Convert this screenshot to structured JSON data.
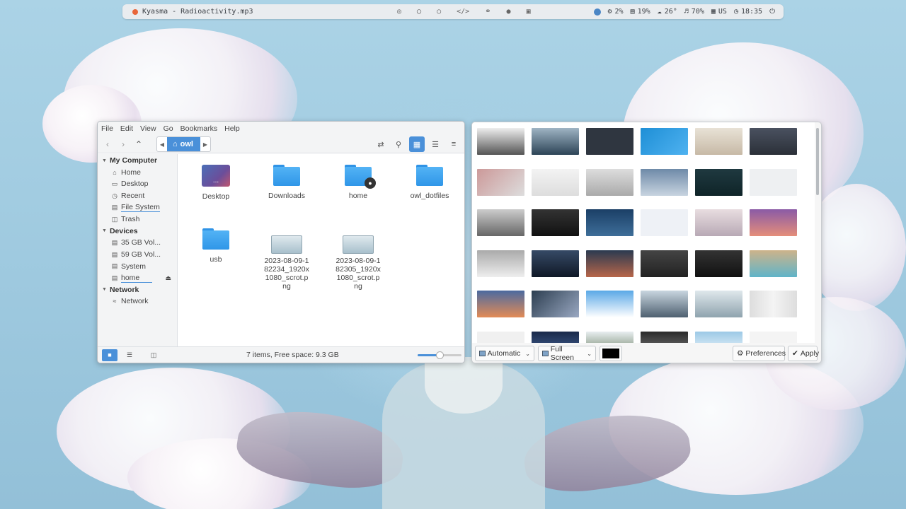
{
  "topbar": {
    "media_title": "Kyasma - Radioactivity.mp3",
    "cpu": "2%",
    "mem": "19%",
    "weather": "26°",
    "volume": "70%",
    "layout": "US",
    "time": "18:35"
  },
  "file_manager": {
    "menu": [
      "File",
      "Edit",
      "View",
      "Go",
      "Bookmarks",
      "Help"
    ],
    "breadcrumb_current": "owl",
    "sidebar": {
      "my_computer": "My Computer",
      "computer_items": [
        "Home",
        "Desktop",
        "Recent",
        "File System",
        "Trash"
      ],
      "devices": "Devices",
      "device_items": [
        "35 GB Vol...",
        "59 GB Vol...",
        "System",
        "home"
      ],
      "network": "Network",
      "network_items": [
        "Network"
      ]
    },
    "items": {
      "desktop": "Desktop",
      "downloads": "Downloads",
      "home": "home",
      "owl_dotfiles": "owl_dotfiles",
      "usb": "usb",
      "scrot1": "2023-08-09-182234_1920x1080_scrot.png",
      "scrot2": "2023-08-09-182305_1920x1080_scrot.png"
    },
    "status": "7 items, Free space: 9.3 GB",
    "zoom_level": 0.5
  },
  "wallpaper_picker": {
    "mode": "Automatic",
    "screen": "Full Screen",
    "color": "#000000",
    "preferences": "Preferences",
    "apply": "Apply"
  },
  "colors": {
    "accent": "#4a90d9",
    "folder": "#3aa3ef"
  }
}
